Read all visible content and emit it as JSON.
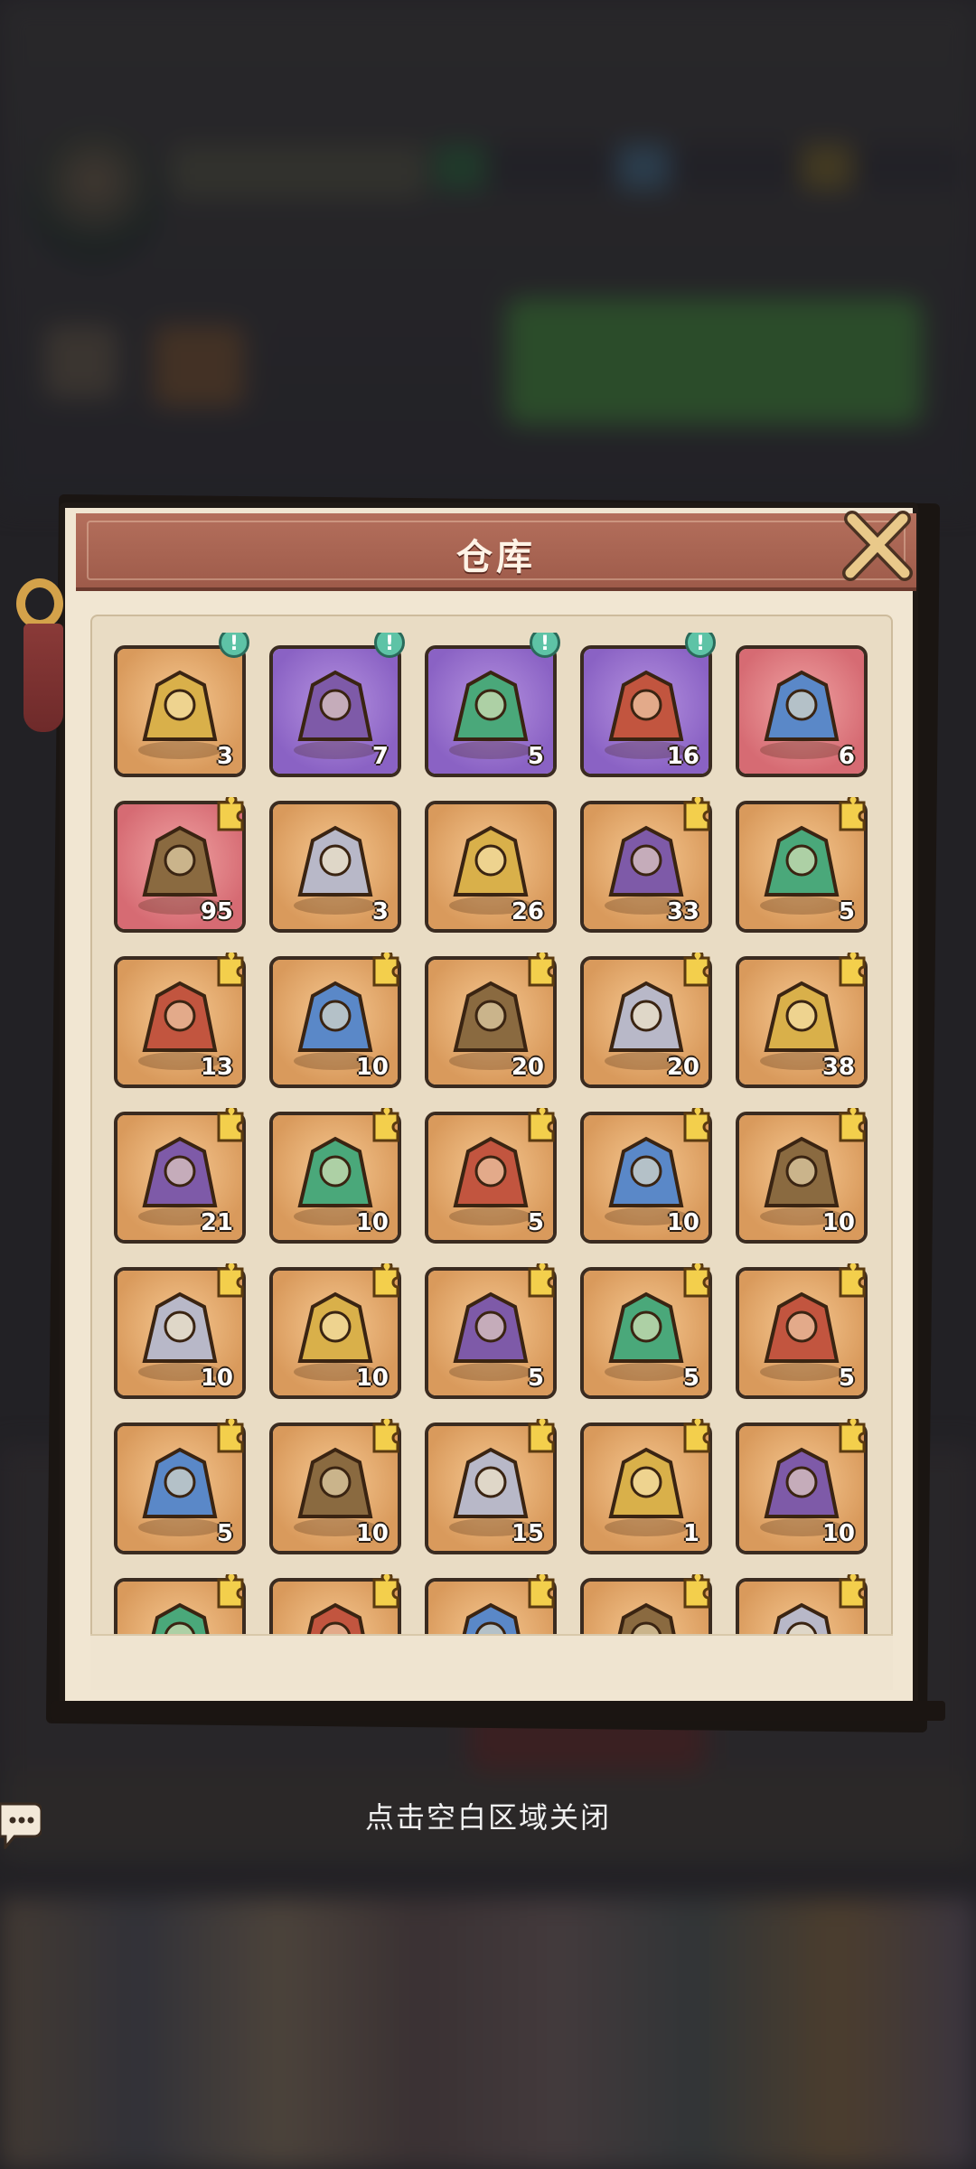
{
  "window": {
    "title": "仓库"
  },
  "footer": {
    "hint": "点击空白区域关闭"
  },
  "colors": {
    "title_bar": "#a8624f",
    "panel": "#f1e6d2",
    "slot_orange": "#e7ae72",
    "slot_purple": "#9d75d2",
    "slot_red": "#e08a8e",
    "alert_badge": "#5ec3a6",
    "puzzle_badge": "#f3cf4c"
  },
  "items": [
    {
      "name": "gold-chest-icon",
      "count": "3",
      "rarity": "orange",
      "badge": "alert"
    },
    {
      "name": "purple-chest-scroll-icon",
      "count": "7",
      "rarity": "purple",
      "badge": "alert"
    },
    {
      "name": "purple-chest-puzzle-icon",
      "count": "5",
      "rarity": "purple",
      "badge": "alert"
    },
    {
      "name": "purple-chest-gems-icon",
      "count": "16",
      "rarity": "purple",
      "badge": "alert"
    },
    {
      "name": "green-orb-icon",
      "count": "6",
      "rarity": "red",
      "badge": "none"
    },
    {
      "name": "bronze-cauldron-icon",
      "count": "95",
      "rarity": "red",
      "badge": "puzzle"
    },
    {
      "name": "gold-key-icon",
      "count": "3",
      "rarity": "orange",
      "badge": "none"
    },
    {
      "name": "talisman-paper-icon",
      "count": "26",
      "rarity": "orange",
      "badge": "none"
    },
    {
      "name": "pagoda-icon",
      "count": "33",
      "rarity": "orange",
      "badge": "puzzle"
    },
    {
      "name": "golden-axe-icon",
      "count": "5",
      "rarity": "orange",
      "badge": "puzzle"
    },
    {
      "name": "green-claw-icon",
      "count": "13",
      "rarity": "orange",
      "badge": "puzzle"
    },
    {
      "name": "blue-mirror-icon",
      "count": "10",
      "rarity": "orange",
      "badge": "puzzle"
    },
    {
      "name": "fire-wheel-icon",
      "count": "20",
      "rarity": "orange",
      "badge": "puzzle"
    },
    {
      "name": "tripod-cauldron-icon",
      "count": "20",
      "rarity": "orange",
      "badge": "puzzle"
    },
    {
      "name": "sword-icon",
      "count": "38",
      "rarity": "orange",
      "badge": "puzzle"
    },
    {
      "name": "dark-pendant-icon",
      "count": "21",
      "rarity": "orange",
      "badge": "puzzle"
    },
    {
      "name": "crystal-tree-icon",
      "count": "10",
      "rarity": "orange",
      "badge": "puzzle"
    },
    {
      "name": "scale-icon",
      "count": "5",
      "rarity": "orange",
      "badge": "puzzle"
    },
    {
      "name": "dragon-frame-gold-icon",
      "count": "10",
      "rarity": "orange",
      "badge": "puzzle"
    },
    {
      "name": "dragon-frame-silver-icon",
      "count": "10",
      "rarity": "orange",
      "badge": "puzzle"
    },
    {
      "name": "dragon-frame-purple-icon",
      "count": "10",
      "rarity": "orange",
      "badge": "puzzle"
    },
    {
      "name": "hero-silver-hair-man-icon",
      "count": "10",
      "rarity": "orange",
      "badge": "puzzle"
    },
    {
      "name": "hero-white-fox-icon",
      "count": "5",
      "rarity": "orange",
      "badge": "puzzle"
    },
    {
      "name": "hero-green-hair-girl-icon",
      "count": "5",
      "rarity": "orange",
      "badge": "puzzle"
    },
    {
      "name": "hero-dark-warrior-girl-icon",
      "count": "5",
      "rarity": "orange",
      "badge": "puzzle"
    },
    {
      "name": "hero-silver-hair-lady-icon",
      "count": "5",
      "rarity": "orange",
      "badge": "puzzle"
    },
    {
      "name": "hero-grey-hair-man-icon",
      "count": "10",
      "rarity": "orange",
      "badge": "puzzle"
    },
    {
      "name": "hero-blue-hair-girl-icon",
      "count": "15",
      "rarity": "orange",
      "badge": "puzzle"
    },
    {
      "name": "hero-black-hair-girl-icon",
      "count": "1",
      "rarity": "orange",
      "badge": "puzzle"
    },
    {
      "name": "hero-white-hair-kid-icon",
      "count": "10",
      "rarity": "orange",
      "badge": "puzzle"
    },
    {
      "name": "hero-red-partial-icon",
      "count": "",
      "rarity": "orange",
      "badge": "puzzle"
    },
    {
      "name": "hero-dark-hair-partial-icon",
      "count": "",
      "rarity": "orange",
      "badge": "puzzle"
    },
    {
      "name": "hero-grey-partial-icon",
      "count": "",
      "rarity": "orange",
      "badge": "puzzle"
    },
    {
      "name": "hero-purple-partial-icon",
      "count": "",
      "rarity": "orange",
      "badge": "puzzle"
    },
    {
      "name": "hero-white-partial-icon",
      "count": "",
      "rarity": "orange",
      "badge": "puzzle"
    }
  ]
}
